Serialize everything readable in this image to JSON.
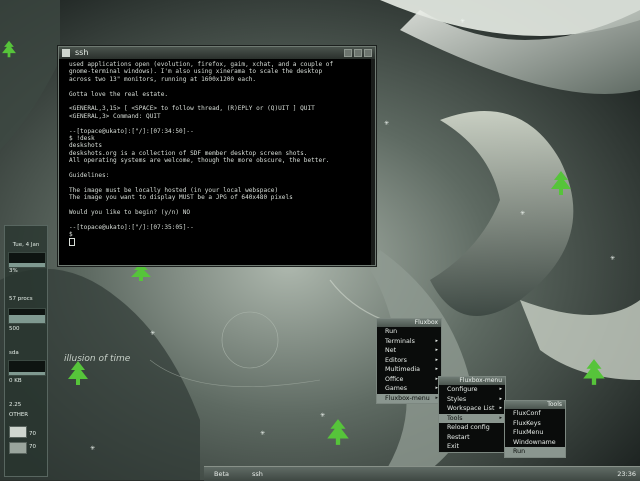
{
  "colors": {
    "accent": "#8a968f",
    "terminal_bg": "#000000",
    "tree": "#56c43a"
  },
  "terminal": {
    "title": "ssh",
    "lines": [
      "used applications open (evolution, firefox, gaim, xchat, and a couple of",
      "gnome-terminal windows). I'm also using xinerama to scale the desktop",
      "across two 13\" monitors, running at 1600x1200 each.",
      "",
      "Gotta love the real estate.",
      "",
      "<GENERAL,3,15> [ <SPACE> to follow thread, (R)EPLY or (Q)UIT ] QUIT",
      "<GENERAL,3> Command: QUIT",
      "",
      "--[topace@ukato]:[\"/]:[07:34:50]--",
      "$ !desk",
      "deskshots",
      "deskshots.org is a collection of SDF member desktop screen shots.",
      "All operating systems are welcome, though the more obscure, the better.",
      "",
      "Guidelines:",
      "",
      "The image must be locally hosted (in your local webspace)",
      "The image you want to display MUST be a JPG of 640x480 pixels",
      "",
      "Would you like to begin? (y/n) NO",
      "",
      "--[topace@ukato]:[\"/]:[07:35:05]--",
      "$ "
    ]
  },
  "dock": {
    "top_label": "Tue, 4 Jan",
    "cpu_label": "3%",
    "mem_label": "500",
    "load_label": "57 procs",
    "net_label": "0 KB",
    "disk_label": "sda",
    "bottom_a": "2.25",
    "bottom_b": "OTHER",
    "bottom_c": "70",
    "bottom_d": "70",
    "cpu_fill": 0.3,
    "mem_fill": 0.6,
    "net_fill": 0.2
  },
  "menus": {
    "root": {
      "title": "Fluxbox",
      "items": [
        {
          "label": "Run",
          "sub": false
        },
        {
          "label": "Terminals",
          "sub": true
        },
        {
          "label": "Net",
          "sub": true
        },
        {
          "label": "Editors",
          "sub": true
        },
        {
          "label": "Multimedia",
          "sub": true
        },
        {
          "label": "Office",
          "sub": true
        },
        {
          "label": "Games",
          "sub": true
        },
        {
          "label": "Fluxbox-menu",
          "sub": true
        }
      ]
    },
    "fluxbox": {
      "title": "Fluxbox-menu",
      "items": [
        {
          "label": "Configure",
          "sub": true
        },
        {
          "label": "Styles",
          "sub": true
        },
        {
          "label": "Workspace List",
          "sub": true
        },
        {
          "label": "Tools",
          "sub": true
        },
        {
          "label": "Reload config",
          "sub": false
        },
        {
          "label": "Restart",
          "sub": false
        },
        {
          "label": "Exit",
          "sub": false
        }
      ]
    },
    "tools": {
      "title": "Tools",
      "items": [
        {
          "label": "FluxConf",
          "sub": false
        },
        {
          "label": "FluxKeys",
          "sub": false
        },
        {
          "label": "FluxMenu",
          "sub": false
        },
        {
          "label": "Windowname",
          "sub": false
        },
        {
          "label": "Run",
          "sub": false
        }
      ]
    }
  },
  "wallpaper_text": {
    "illusion": "illusion of time"
  },
  "taskbar": {
    "workspace": "Beta",
    "task": "ssh",
    "clock": "23:36"
  }
}
